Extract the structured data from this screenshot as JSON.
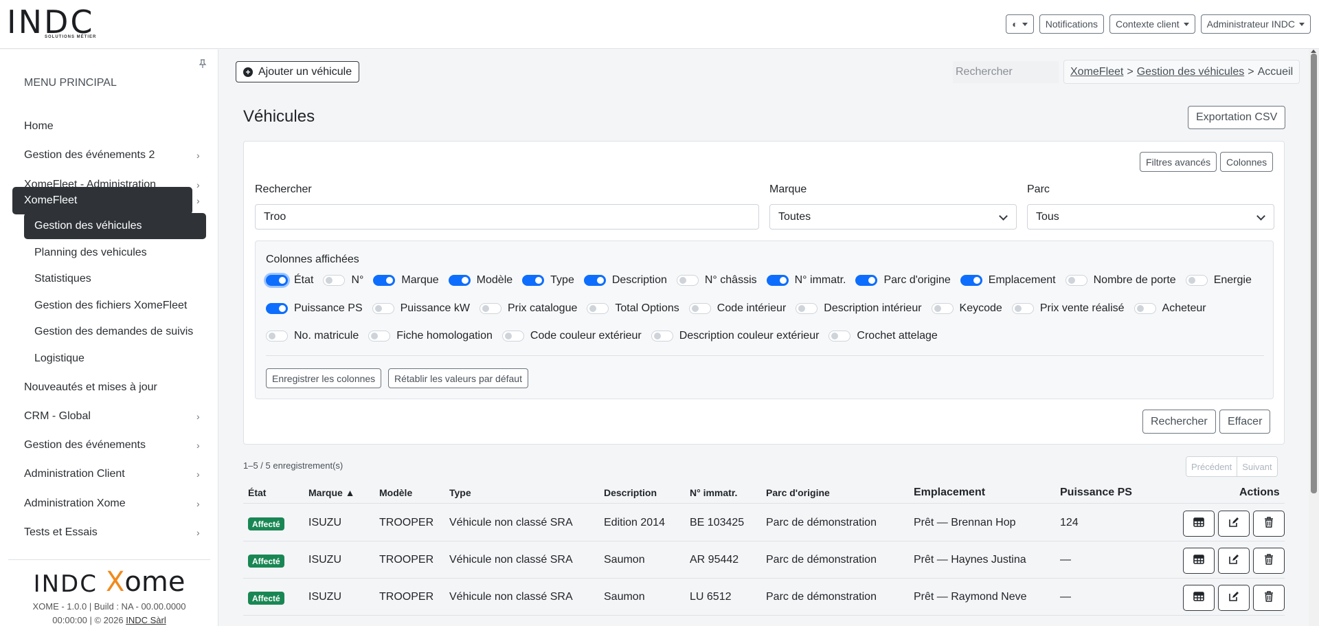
{
  "header": {
    "logo_text": "INDC",
    "logo_subtitle": "SOLUTIONS MÉTIER",
    "theme_label": "◐",
    "notifications_label": "Notifications",
    "client_context_label": "Contexte client",
    "user_label": "Administrateur INDC"
  },
  "sidebar": {
    "menu_title": "MENU PRINCIPAL",
    "items": [
      {
        "label": "Home"
      },
      {
        "label": "Gestion des événements 2"
      },
      {
        "label": "XomeFleet - Administration"
      },
      {
        "label": "XomeFleet"
      },
      {
        "label": "Nouveautés et mises à jour"
      },
      {
        "label": "CRM - Global"
      },
      {
        "label": "Gestion des événements"
      },
      {
        "label": "Administration Client"
      },
      {
        "label": "Administration Xome"
      },
      {
        "label": "Tests et Essais"
      }
    ],
    "sub_items": [
      {
        "label": "Gestion des véhicules"
      },
      {
        "label": "Planning des vehicules"
      },
      {
        "label": "Statistiques"
      },
      {
        "label": "Gestion des fichiers XomeFleet"
      },
      {
        "label": "Gestion des demandes de suivis"
      },
      {
        "label": "Logistique"
      }
    ],
    "footer": {
      "logo_indc": "INDC",
      "logo_xome": "ome",
      "logo_xome_x": "X",
      "version_line": "XOME - 1.0.0 | Build : NA - 00.00.0000",
      "copyright_line": "00:00:00 | © 2026",
      "company_link": "INDC Sàrl"
    }
  },
  "toolbar": {
    "add_vehicle_label": "Ajouter un véhicule",
    "search_placeholder": "Rechercher",
    "breadcrumb": {
      "level1": "XomeFleet",
      "level2": "Gestion des véhicules",
      "current": "Accueil",
      "separator": ">"
    }
  },
  "page": {
    "title": "Véhicules",
    "export_label": "Exportation CSV"
  },
  "filters": {
    "advanced_label": "Filtres avancés",
    "columns_label": "Colonnes",
    "search_label": "Rechercher",
    "search_value": "Troo",
    "brand_label": "Marque",
    "brand_value": "Toutes",
    "park_label": "Parc",
    "park_value": "Tous",
    "columns_panel": {
      "title": "Colonnes affichées",
      "row1": [
        {
          "label": "État",
          "on": true
        },
        {
          "label": "N°",
          "on": false
        },
        {
          "label": "Marque",
          "on": true
        },
        {
          "label": "Modèle",
          "on": true
        },
        {
          "label": "Type",
          "on": true
        },
        {
          "label": "Description",
          "on": true
        },
        {
          "label": "N° châssis",
          "on": false
        },
        {
          "label": "N° immatr.",
          "on": true
        },
        {
          "label": "Parc d'origine",
          "on": true
        },
        {
          "label": "Emplacement",
          "on": true
        },
        {
          "label": "Nombre de porte",
          "on": false
        },
        {
          "label": "Energie",
          "on": false
        }
      ],
      "row2": [
        {
          "label": "Puissance PS",
          "on": true
        },
        {
          "label": "Puissance kW",
          "on": false
        },
        {
          "label": "Prix catalogue",
          "on": false
        },
        {
          "label": "Total Options",
          "on": false
        },
        {
          "label": "Code intérieur",
          "on": false
        },
        {
          "label": "Description intérieur",
          "on": false
        },
        {
          "label": "Keycode",
          "on": false
        },
        {
          "label": "Prix vente réalisé",
          "on": false
        },
        {
          "label": "Acheteur",
          "on": false
        }
      ],
      "row3": [
        {
          "label": "No. matricule",
          "on": false
        },
        {
          "label": "Fiche homologation",
          "on": false
        },
        {
          "label": "Code couleur extérieur",
          "on": false
        },
        {
          "label": "Description couleur extérieur",
          "on": false
        },
        {
          "label": "Crochet attelage",
          "on": false
        }
      ],
      "save_label": "Enregistrer les colonnes",
      "reset_label": "Rétablir les valeurs par défaut"
    },
    "search_button": "Rechercher",
    "clear_button": "Effacer"
  },
  "results": {
    "count_text": "1–5 / 5 enregistrement(s)",
    "prev_label": "Précédent",
    "next_label": "Suivant",
    "columns": {
      "etat": "État",
      "marque": "Marque ▲",
      "modele": "Modèle",
      "type": "Type",
      "description": "Description",
      "immat": "N° immatr.",
      "parc": "Parc d'origine",
      "emplacement": "Emplacement",
      "puissance": "Puissance PS",
      "actions": "Actions"
    },
    "rows": [
      {
        "etat": "Affecté",
        "marque": "ISUZU",
        "modele": "TROOPER",
        "type": "Véhicule non classé SRA",
        "description": "Edition 2014",
        "immat": "BE 103425",
        "parc": "Parc de démonstration",
        "emplacement": "Prêt — Brennan Hop",
        "puissance": "124"
      },
      {
        "etat": "Affecté",
        "marque": "ISUZU",
        "modele": "TROOPER",
        "type": "Véhicule non classé SRA",
        "description": "Saumon",
        "immat": "AR 95442",
        "parc": "Parc de démonstration",
        "emplacement": "Prêt — Haynes Justina",
        "puissance": "—"
      },
      {
        "etat": "Affecté",
        "marque": "ISUZU",
        "modele": "TROOPER",
        "type": "Véhicule non classé SRA",
        "description": "Saumon",
        "immat": "LU 6512",
        "parc": "Parc de démonstration",
        "emplacement": "Prêt — Raymond Neve",
        "puissance": "—"
      }
    ]
  },
  "colors": {
    "accent": "#0d6efd",
    "sidebar_active": "#2f3338",
    "badge_success": "#198754",
    "logo_orange": "#f08a1c"
  }
}
